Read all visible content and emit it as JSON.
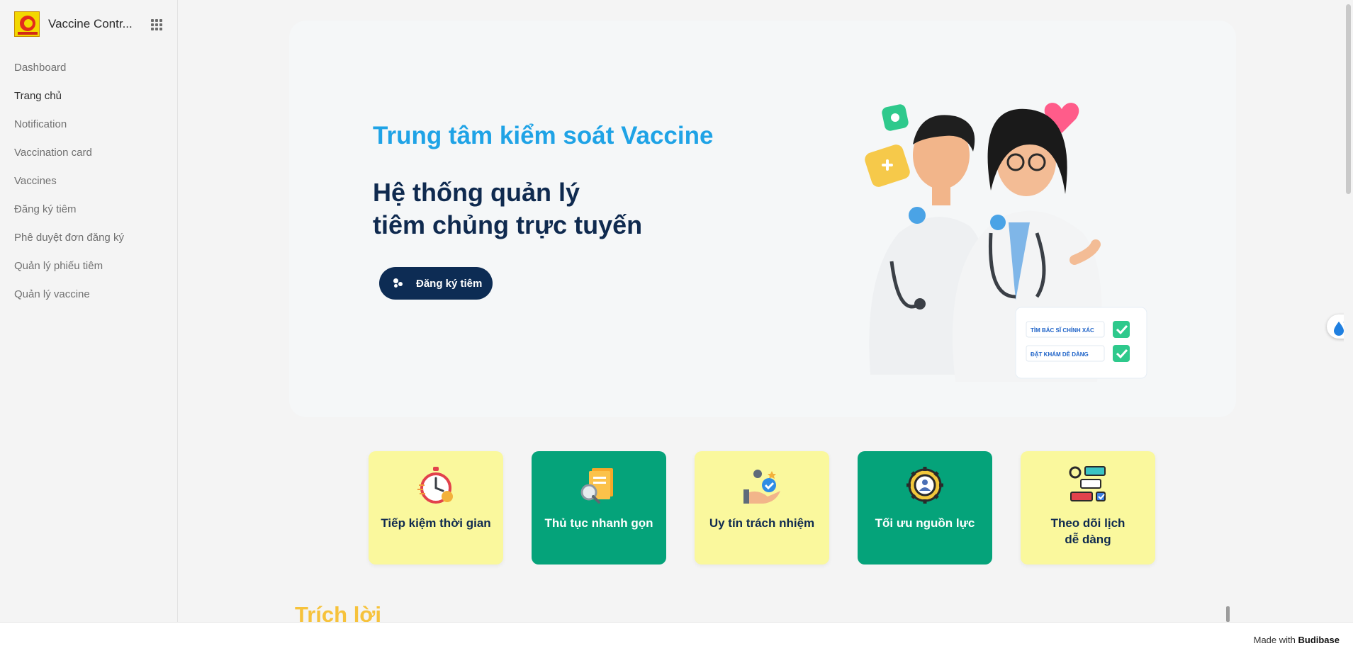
{
  "app": {
    "title": "Vaccine Contr...",
    "logo_alt": "Trung tâm kiểm soát"
  },
  "sidebar": {
    "items": [
      {
        "label": "Dashboard"
      },
      {
        "label": "Trang chủ"
      },
      {
        "label": "Notification"
      },
      {
        "label": "Vaccination card"
      },
      {
        "label": "Vaccines"
      },
      {
        "label": "Đăng ký tiêm"
      },
      {
        "label": "Phê duyệt đơn đăng ký"
      },
      {
        "label": "Quản lý phiếu tiêm"
      },
      {
        "label": "Quản lý vaccine"
      }
    ],
    "active_index": 1
  },
  "hero": {
    "subtitle": "Trung tâm kiểm soát Vaccine",
    "title_line1": "Hệ thống quản lý",
    "title_line2": "tiêm chủng trực tuyến",
    "cta_label": "Đăng ký tiêm",
    "checklist": [
      "TÌM BÁC SĨ CHÍNH XÁC",
      "ĐẶT KHÁM DỄ DÀNG"
    ]
  },
  "features": [
    {
      "line1": "Tiếp kiệm thời gian",
      "line2": "",
      "icon": "stopwatch-icon",
      "theme": "yellow"
    },
    {
      "line1": "Thủ tục nhanh gọn",
      "line2": "",
      "icon": "documents-search-icon",
      "theme": "green"
    },
    {
      "line1": "Uy tín trách nhiệm",
      "line2": "",
      "icon": "trust-hand-icon",
      "theme": "yellow"
    },
    {
      "line1": "Tối ưu nguồn lực",
      "line2": "",
      "icon": "resource-gear-icon",
      "theme": "green"
    },
    {
      "line1": "Theo dõi lịch",
      "line2": "dễ dàng",
      "icon": "schedule-flow-icon",
      "theme": "yellow"
    }
  ],
  "section": {
    "heading": "Trích lời"
  },
  "footer": {
    "made_with": "Made with",
    "brand": "Budibase"
  },
  "colors": {
    "accent_blue": "#1fa3e6",
    "navy": "#0d2c54",
    "card_yellow": "#faf89d",
    "card_green": "#05a37a",
    "heading_yellow": "#f6c23b"
  }
}
